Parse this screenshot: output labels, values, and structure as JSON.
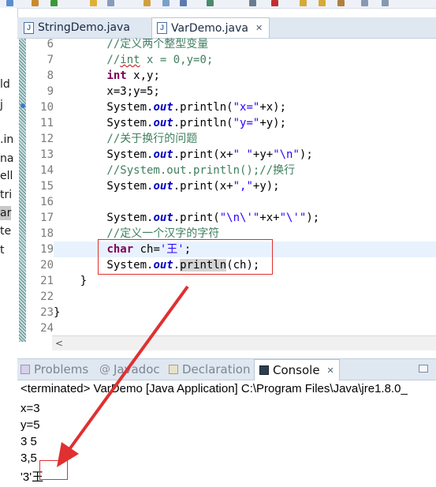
{
  "left_explorer": {
    "items": [
      "ld",
      "j",
      ".in",
      "na",
      "ell",
      "tri",
      "ar",
      "te",
      "t"
    ]
  },
  "editor_tabs": [
    {
      "label": "StringDemo.java",
      "active": false
    },
    {
      "label": "VarDemo.java",
      "active": true
    }
  ],
  "code_lines": [
    {
      "num": "6",
      "tokens": [
        [
          "cm",
          "        //定义两个整型变量"
        ]
      ]
    },
    {
      "num": "7",
      "tokens": [
        [
          "cm",
          "        //"
        ],
        [
          "cmsq",
          "int"
        ],
        [
          "cm",
          " x = 0,y=0;"
        ]
      ]
    },
    {
      "num": "8",
      "tokens": [
        [
          "",
          "        "
        ],
        [
          "kw",
          "int"
        ],
        [
          "",
          " x,y;"
        ]
      ]
    },
    {
      "num": "9",
      "tokens": [
        [
          "",
          "        x=3;y=5;"
        ]
      ]
    },
    {
      "num": "10",
      "tokens": [
        [
          "",
          "        System."
        ],
        [
          "fi",
          "out"
        ],
        [
          "",
          ".println("
        ],
        [
          "st",
          "\"x=\""
        ],
        [
          "",
          "+x);"
        ]
      ]
    },
    {
      "num": "11",
      "tokens": [
        [
          "",
          "        System."
        ],
        [
          "fi",
          "out"
        ],
        [
          "",
          ".println("
        ],
        [
          "st",
          "\"y=\""
        ],
        [
          "",
          "+y);"
        ]
      ]
    },
    {
      "num": "12",
      "tokens": [
        [
          "cm",
          "        //关于换行的问题"
        ]
      ]
    },
    {
      "num": "13",
      "tokens": [
        [
          "",
          "        System."
        ],
        [
          "fi",
          "out"
        ],
        [
          "",
          ".print(x+"
        ],
        [
          "st",
          "\" \""
        ],
        [
          "",
          "+y+"
        ],
        [
          "st",
          "\"\\n\""
        ],
        [
          "",
          ");"
        ]
      ]
    },
    {
      "num": "14",
      "tokens": [
        [
          "cm",
          "        //System.out.println();//换行"
        ]
      ]
    },
    {
      "num": "15",
      "tokens": [
        [
          "",
          "        System."
        ],
        [
          "fi",
          "out"
        ],
        [
          "",
          ".print(x+"
        ],
        [
          "st",
          "\",\""
        ],
        [
          "",
          "+y);"
        ]
      ]
    },
    {
      "num": "16",
      "tokens": []
    },
    {
      "num": "17",
      "tokens": [
        [
          "",
          "        System."
        ],
        [
          "fi",
          "out"
        ],
        [
          "",
          ".print("
        ],
        [
          "st",
          "\"\\n\\'\""
        ],
        [
          "",
          "+x+"
        ],
        [
          "st",
          "\"\\'\""
        ],
        [
          "",
          ");"
        ]
      ]
    },
    {
      "num": "18",
      "tokens": [
        [
          "cm",
          "        //定义一个汉字的字符"
        ]
      ]
    },
    {
      "num": "19",
      "tokens": [
        [
          "",
          "        "
        ],
        [
          "kw",
          "char"
        ],
        [
          "",
          " ch="
        ],
        [
          "st",
          "'王'"
        ],
        [
          "",
          ";"
        ]
      ]
    },
    {
      "num": "20",
      "tokens": [
        [
          "",
          "        System."
        ],
        [
          "fi",
          "out"
        ],
        [
          "",
          "."
        ],
        [
          "hl",
          "println"
        ],
        [
          "",
          "(ch);"
        ]
      ]
    },
    {
      "num": "21",
      "tokens": [
        [
          "",
          "    }"
        ]
      ]
    },
    {
      "num": "22",
      "tokens": []
    },
    {
      "num": "23",
      "tokens": [
        [
          "",
          "}"
        ]
      ]
    },
    {
      "num": "24",
      "tokens": []
    }
  ],
  "current_line": "19",
  "scroll_left_glyph": "<",
  "panel_tabs": [
    {
      "label": "Problems",
      "icon": "problems-icon",
      "active": false
    },
    {
      "label": "Javadoc",
      "icon": "at-icon",
      "active": false
    },
    {
      "label": "Declaration",
      "icon": "declaration-icon",
      "active": false
    },
    {
      "label": "Console",
      "icon": "console-icon",
      "active": true
    }
  ],
  "console": {
    "header": "<terminated> VarDemo [Java Application] C:\\Program Files\\Java\\jre1.8.0_",
    "output_lines": [
      "x=3",
      "y=5",
      "3 5",
      "3,5",
      "'3'王"
    ]
  },
  "colors": {
    "keyword": "#7f0055",
    "comment": "#3f7f5f",
    "string": "#2a00ff",
    "field": "#0000c0",
    "annotation_red": "#e03030"
  }
}
